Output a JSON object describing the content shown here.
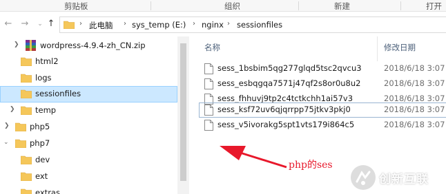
{
  "ribbon": {
    "groups": [
      "剪贴板",
      "组织",
      "新建",
      "打开"
    ]
  },
  "nav": {
    "breadcrumb": [
      "此电脑",
      "sys_temp (E:)",
      "nginx",
      "sessionfiles"
    ]
  },
  "tree": {
    "items": [
      {
        "label": "wordpress-4.9.4-zh_CN.zip",
        "icon": "winrar-archive-icon",
        "expander": "collapsed"
      },
      {
        "label": "html2",
        "icon": "folder-icon",
        "expander": "none"
      },
      {
        "label": "logs",
        "icon": "folder-icon",
        "expander": "none"
      },
      {
        "label": "sessionfiles",
        "icon": "folder-icon",
        "expander": "none",
        "selected": true
      },
      {
        "label": "temp",
        "icon": "folder-icon",
        "expander": "collapsed"
      },
      {
        "label": "php5",
        "icon": "folder-icon",
        "expander": "collapsed"
      },
      {
        "label": "php7",
        "icon": "folder-icon",
        "expander": "expanded"
      },
      {
        "label": "dev",
        "icon": "folder-icon",
        "expander": "none"
      },
      {
        "label": "ext",
        "icon": "folder-icon",
        "expander": "none"
      },
      {
        "label": "extras",
        "icon": "folder-icon",
        "expander": "none"
      }
    ]
  },
  "files": {
    "headers": {
      "name": "名称",
      "modified": "修改日期"
    },
    "rows": [
      {
        "name": "sess_1bsbim5qg277glqd5tsc2qvcu3",
        "date": "2018/6/18 3:07"
      },
      {
        "name": "sess_esbqgqa7571j47qf2s8or0u8u2",
        "date": "2018/6/18 3:07"
      },
      {
        "name": "sess_fhhuvj9tp2c4tctkchh1ai57v3",
        "date": "2018/6/18 3:07"
      },
      {
        "name": "sess_ksf72uv6qjqrrpp75jtkv3pkj0",
        "date": "2018/6/18 3:07",
        "focused": true
      },
      {
        "name": "sess_v5ivorakg5spt1vts179i864c5",
        "date": "2018/6/18 3:07"
      }
    ]
  },
  "annotation": {
    "text": "php的ses",
    "color": "#e8182b"
  },
  "watermark": {
    "text": "创新互联"
  },
  "colors": {
    "selection_bg": "#cce8ff",
    "folder": "#f5c75a",
    "header_text": "#4c607a"
  }
}
